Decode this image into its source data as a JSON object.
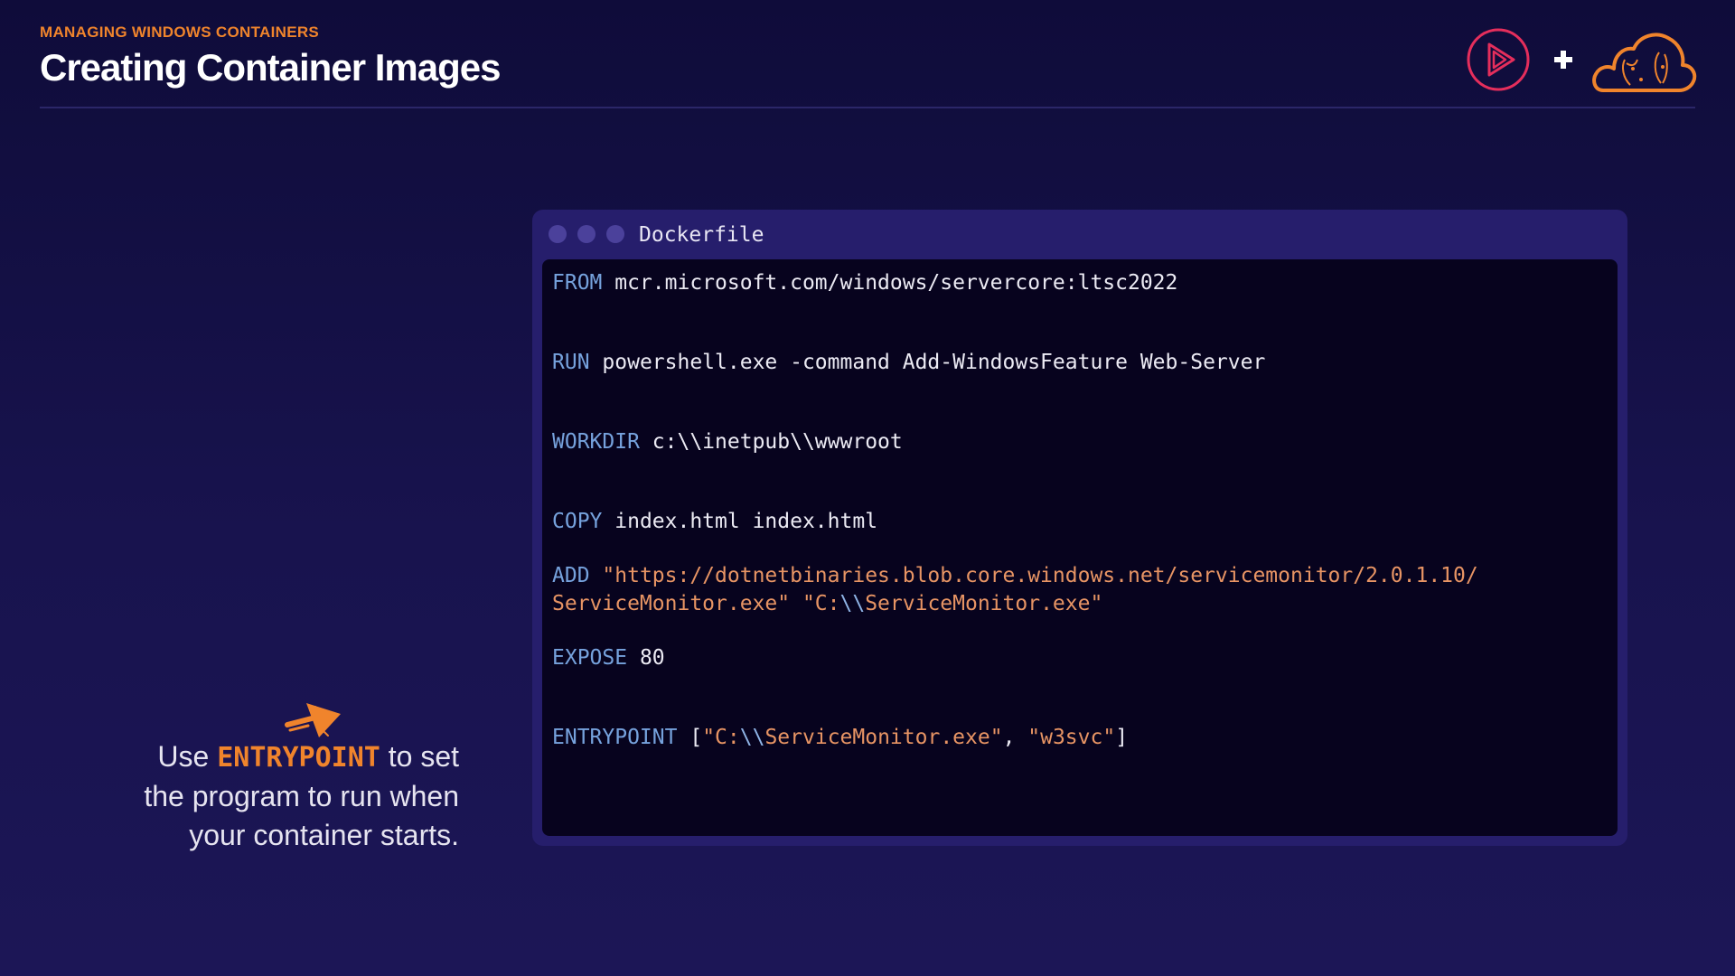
{
  "header": {
    "eyebrow": "MANAGING WINDOWS CONTAINERS",
    "title": "Creating Container Images"
  },
  "logos": {
    "play": "play-logo-icon",
    "plus": "plus-icon",
    "cloud": "cloud-logo-icon",
    "colors": {
      "play": "#e52e5c",
      "cloud": "#f0842c"
    }
  },
  "window": {
    "title": "Dockerfile",
    "code": {
      "from": {
        "keyword": "FROM",
        "arg": "mcr.microsoft.com/windows/servercore:ltsc2022"
      },
      "run": {
        "keyword": "RUN",
        "arg": "powershell.exe -command Add-WindowsFeature Web-Server"
      },
      "workdir": {
        "keyword": "WORKDIR",
        "arg": "c:\\\\inetpub\\\\wwwroot"
      },
      "copy": {
        "keyword": "COPY",
        "arg": "index.html index.html"
      },
      "add": {
        "keyword": "ADD",
        "line1": "\"https://dotnetbinaries.blob.core.windows.net/servicemonitor/2.0.1.10/",
        "line2_part1": "ServiceMonitor.exe\" \"C:",
        "line2_escape": "\\\\",
        "line2_part2": "ServiceMonitor.exe\""
      },
      "expose": {
        "keyword": "EXPOSE",
        "arg": "80"
      },
      "entrypoint": {
        "keyword": "ENTRYPOINT",
        "open": "[",
        "str1_part1": "\"C:",
        "str1_escape": "\\\\",
        "str1_part2": "ServiceMonitor.exe\"",
        "separator": ", ",
        "str2": "\"w3svc\"",
        "close": "]"
      }
    }
  },
  "caption": {
    "before": "Use ",
    "highlight": "ENTRYPOINT",
    "after_line1": " to set",
    "line2": "the program to run when",
    "line3": "your container starts."
  },
  "colors": {
    "accent": "#f0842c",
    "keyword": "#76a2dd",
    "string": "#e79464",
    "background": "#16114a",
    "code_background": "#07031e"
  }
}
